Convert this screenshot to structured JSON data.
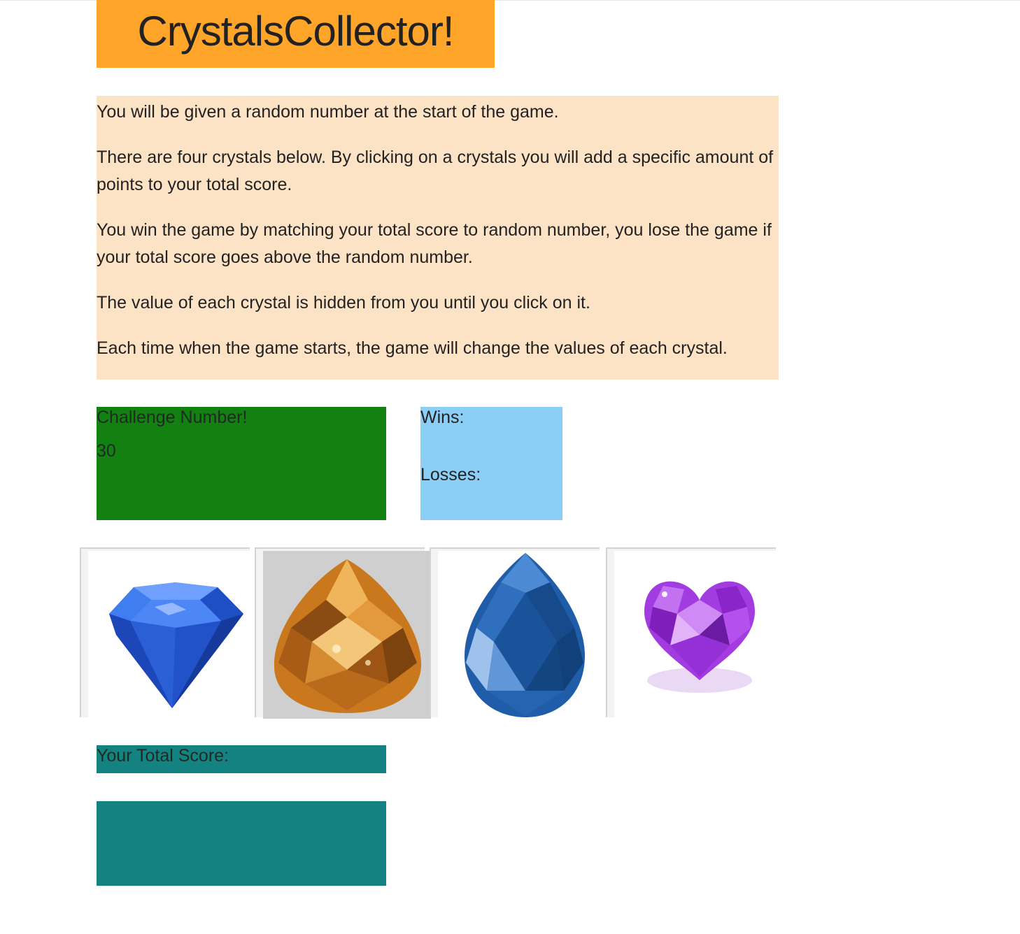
{
  "header": {
    "title": "CrystalsCollector!"
  },
  "instructions": [
    "You will be given a random number at the start of the game.",
    "There are four crystals below. By clicking on a crystals you will add a specific amount of points to your total score.",
    "You win the game by matching your total score to random number, you lose the game if your total score goes above the random number.",
    "The value of each crystal is hidden from you until you click on it.",
    "Each time when the game starts, the game will change the values of each crystal."
  ],
  "challenge": {
    "label": "Challenge Number!",
    "value": "30"
  },
  "scoreboard": {
    "wins_label": "Wins:",
    "losses_label": "Losses:"
  },
  "crystals": [
    {
      "name": "blue-diamond-crystal",
      "color": "#2a63e0"
    },
    {
      "name": "amber-pear-crystal",
      "color": "#c9781d"
    },
    {
      "name": "sapphire-teardrop-crystal",
      "color": "#1f5da8"
    },
    {
      "name": "purple-heart-crystal",
      "color": "#a23be0"
    }
  ],
  "total": {
    "label": "Your Total Score:",
    "value": ""
  },
  "colors": {
    "title_bg": "#ffa52a",
    "instructions_bg": "#fde3c6",
    "challenge_bg": "#128112",
    "scoreboard_bg": "#8bcff7",
    "total_bg": "#148280"
  }
}
